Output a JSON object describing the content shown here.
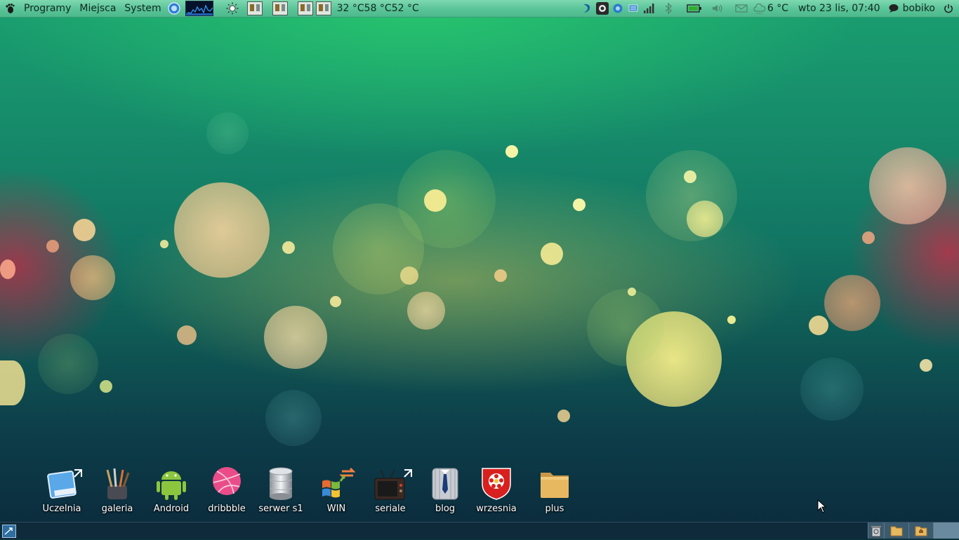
{
  "top_panel": {
    "menus": [
      "Programy",
      "Miejsca",
      "System"
    ],
    "temperatures": "32 °C58 °C52 °C",
    "weather": "6 °C",
    "clock": "wto 23 lis, 07:40",
    "user": "bobiko"
  },
  "desktop_icons": [
    {
      "label": "Uczelnia",
      "icon": "folder-link-icon"
    },
    {
      "label": "galeria",
      "icon": "brushes-icon"
    },
    {
      "label": "Android",
      "icon": "android-icon"
    },
    {
      "label": "dribbble",
      "icon": "dribbble-icon"
    },
    {
      "label": "serwer s1",
      "icon": "server-icon"
    },
    {
      "label": "WIN",
      "icon": "windows-icon"
    },
    {
      "label": "seriale",
      "icon": "tv-icon"
    },
    {
      "label": "blog",
      "icon": "shirt-tie-icon"
    },
    {
      "label": "wrzesnia",
      "icon": "crest-icon"
    },
    {
      "label": "plus",
      "icon": "folder-icon"
    }
  ],
  "colors": {
    "top_panel": "#5cc59a",
    "bottom_panel": "#0f2a3a"
  }
}
